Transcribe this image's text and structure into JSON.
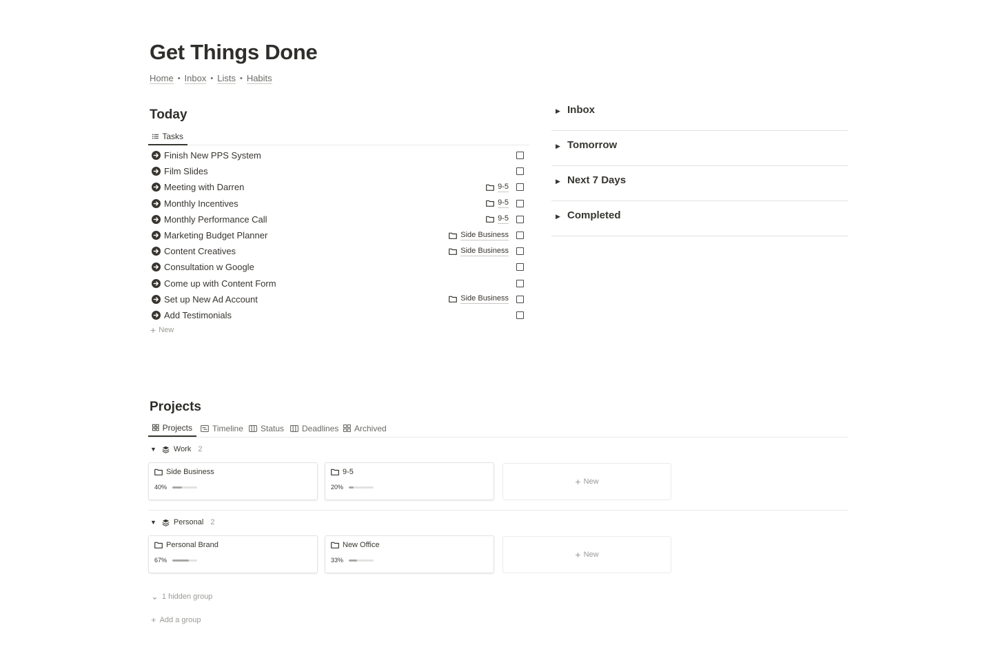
{
  "page": {
    "title": "Get Things Done",
    "breadcrumb": [
      "Home",
      "Inbox",
      "Lists",
      "Habits"
    ]
  },
  "today": {
    "title": "Today",
    "tab_label": "Tasks",
    "tasks": [
      {
        "name": "Finish New PPS System",
        "project": "",
        "done": false
      },
      {
        "name": "Film Slides",
        "project": "",
        "done": false
      },
      {
        "name": "Meeting with Darren",
        "project": "9-5",
        "done": false
      },
      {
        "name": "Monthly Incentives",
        "project": "9-5",
        "done": false
      },
      {
        "name": "Monthly Performance Call",
        "project": "9-5",
        "done": false
      },
      {
        "name": "Marketing Budget Planner",
        "project": "Side Business",
        "done": false
      },
      {
        "name": "Content Creatives",
        "project": "Side Business",
        "done": false
      },
      {
        "name": "Consultation w Google",
        "project": "",
        "done": false
      },
      {
        "name": "Come up with Content Form",
        "project": "",
        "done": false
      },
      {
        "name": "Set up New Ad Account",
        "project": "Side Business",
        "done": false
      },
      {
        "name": "Add Testimonials",
        "project": "",
        "done": false
      }
    ],
    "new_label": "New"
  },
  "toggles": [
    "Inbox",
    "Tomorrow",
    "Next 7 Days",
    "Completed"
  ],
  "projects": {
    "title": "Projects",
    "tabs": [
      "Projects",
      "Timeline",
      "Status",
      "Deadlines",
      "Archived"
    ],
    "groups": [
      {
        "name": "Work",
        "count": "2",
        "cards": [
          {
            "name": "Side Business",
            "progress_label": "40%",
            "progress": 0.4
          },
          {
            "name": "9-5",
            "progress_label": "20%",
            "progress": 0.2
          }
        ]
      },
      {
        "name": "Personal",
        "count": "2",
        "cards": [
          {
            "name": "Personal Brand",
            "progress_label": "67%",
            "progress": 0.67
          },
          {
            "name": "New Office",
            "progress_label": "33%",
            "progress": 0.33
          }
        ]
      }
    ],
    "new_card_label": "New",
    "hidden_group_label": "1 hidden group",
    "add_group_label": "Add a group"
  },
  "colors": {
    "text": "#37352f",
    "muted": "#9b9a97",
    "border": "#e3e2e0",
    "progress_fill": "#a8a7a4"
  }
}
